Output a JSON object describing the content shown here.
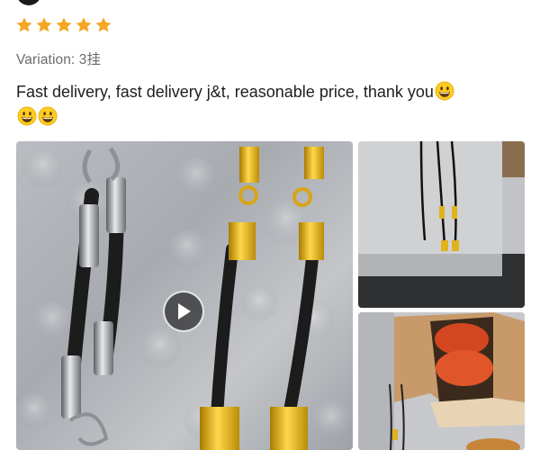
{
  "review": {
    "rating": 5,
    "rating_max": 5,
    "star_color": "#f5a623",
    "variation_text": "Variation: 3挂",
    "text": "Fast delivery, fast delivery j&t, reasonable price, thank you",
    "emoji_count": 3,
    "emoji_name": "grinning-face"
  },
  "media": {
    "main": {
      "type": "video",
      "icon": "play-icon"
    },
    "side_1": {
      "type": "image"
    },
    "side_2": {
      "type": "image"
    }
  }
}
